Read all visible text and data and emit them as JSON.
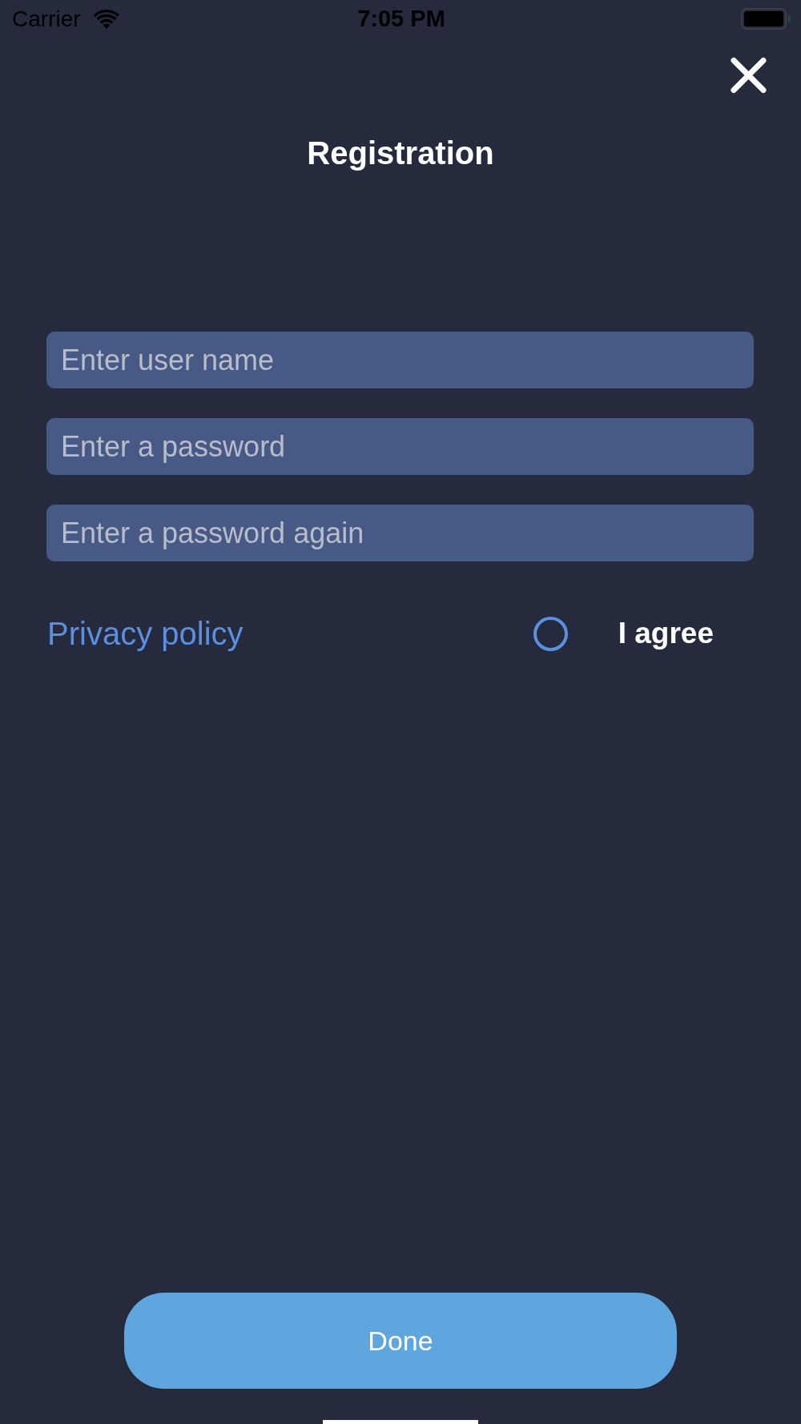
{
  "status_bar": {
    "carrier": "Carrier",
    "time": "7:05 PM"
  },
  "header": {
    "title": "Registration"
  },
  "fields": [
    {
      "placeholder": "Enter user name"
    },
    {
      "placeholder": "Enter a password"
    },
    {
      "placeholder": "Enter a password again"
    }
  ],
  "agreement": {
    "link": "Privacy policy",
    "label": "I agree",
    "checked": false
  },
  "done_button": {
    "label": "Done"
  }
}
